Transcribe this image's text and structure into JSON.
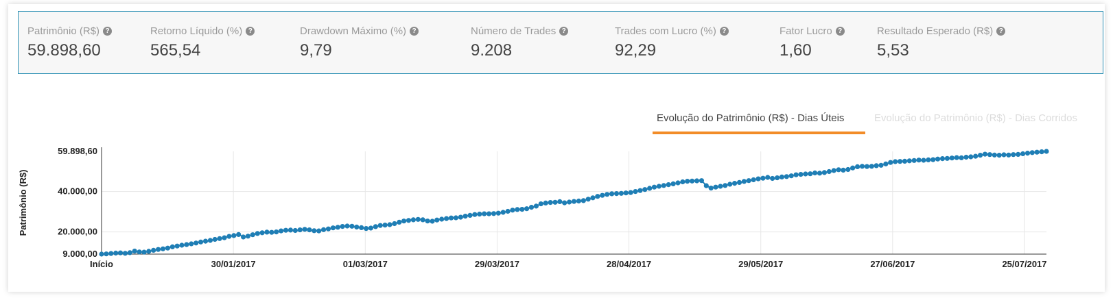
{
  "stats": [
    {
      "label": "Patrimônio (R$)",
      "value": "59.898,60"
    },
    {
      "label": "Retorno Líquido (%)",
      "value": "565,54"
    },
    {
      "label": "Drawdown Máximo (%)",
      "value": "9,79"
    },
    {
      "label": "Número de Trades",
      "value": "9.208"
    },
    {
      "label": "Trades com Lucro (%)",
      "value": "92,29"
    },
    {
      "label": "Fator Lucro",
      "value": "1,60"
    },
    {
      "label": "Resultado Esperado (R$)",
      "value": "5,53"
    }
  ],
  "help_glyph": "?",
  "tabs": [
    {
      "label": "Evolução do Patrimônio (R$) - Dias Úteis",
      "active": true
    },
    {
      "label": "Evolução do Patrimônio (R$) - Dias Corridos",
      "active": false
    }
  ],
  "colors": {
    "accent": "#2a8fb3",
    "series": "#1f7eb5",
    "tab_underline": "#f28c28",
    "grid": "#e6e6e6"
  },
  "chart_data": {
    "type": "line",
    "ylabel": "Patrimônio (R$)",
    "ylim": [
      9000,
      59898.6
    ],
    "y_ticks": [
      9000,
      20000,
      40000,
      59898.6
    ],
    "y_tick_labels": [
      "9.000,00",
      "20.000,00",
      "40.000,00",
      "59.898,60"
    ],
    "x_tick_labels": [
      "Início",
      "30/01/2017",
      "01/03/2017",
      "29/03/2017",
      "28/04/2017",
      "29/05/2017",
      "27/06/2017",
      "25/07/2017"
    ],
    "grid": true,
    "series": [
      {
        "values": [
          9000,
          9100,
          9300,
          9500,
          9600,
          9400,
          9700,
          10500,
          10100,
          10000,
          10400,
          10900,
          11300,
          11600,
          12000,
          12600,
          13000,
          13400,
          13700,
          14100,
          14500,
          15000,
          15400,
          15800,
          16300,
          16700,
          17100,
          17800,
          18200,
          18700,
          17500,
          17900,
          18600,
          19200,
          19600,
          19900,
          19800,
          20000,
          20500,
          20800,
          20900,
          20700,
          21000,
          21300,
          21000,
          20600,
          20500,
          21100,
          21500,
          22000,
          22300,
          22700,
          22900,
          22800,
          22400,
          22100,
          21700,
          21900,
          22600,
          23200,
          23400,
          23600,
          24100,
          24800,
          25400,
          25700,
          26000,
          26200,
          26000,
          25400,
          25300,
          25900,
          26300,
          26600,
          26900,
          27000,
          27300,
          27800,
          28200,
          28600,
          28800,
          29000,
          29000,
          29100,
          29300,
          29700,
          30200,
          30800,
          31100,
          31200,
          31500,
          32200,
          32800,
          33900,
          34300,
          34600,
          34700,
          35000,
          34400,
          34800,
          35100,
          35300,
          35500,
          36200,
          36900,
          37600,
          38100,
          38600,
          38900,
          39000,
          39100,
          39300,
          39500,
          40000,
          40500,
          41000,
          41600,
          42200,
          42600,
          43000,
          43400,
          43800,
          44300,
          44800,
          45100,
          45200,
          45300,
          45400,
          42900,
          41700,
          42200,
          42600,
          43000,
          43600,
          44100,
          44500,
          45000,
          45400,
          45800,
          46300,
          46600,
          47000,
          46500,
          46800,
          47200,
          47400,
          47800,
          48300,
          48500,
          48700,
          48800,
          49200,
          49100,
          49400,
          49900,
          50400,
          50800,
          50600,
          50900,
          51700,
          52300,
          52500,
          52400,
          52500,
          52800,
          53000,
          53700,
          54400,
          54800,
          54900,
          55000,
          55200,
          55400,
          55600,
          55500,
          55700,
          55800,
          56100,
          56300,
          56400,
          56600,
          56800,
          56700,
          57000,
          57200,
          57500,
          58000,
          58500,
          58300,
          58100,
          58000,
          58200,
          58100,
          58300,
          58400,
          58700,
          59000,
          59300,
          59500,
          59700,
          59898.6
        ]
      }
    ]
  }
}
